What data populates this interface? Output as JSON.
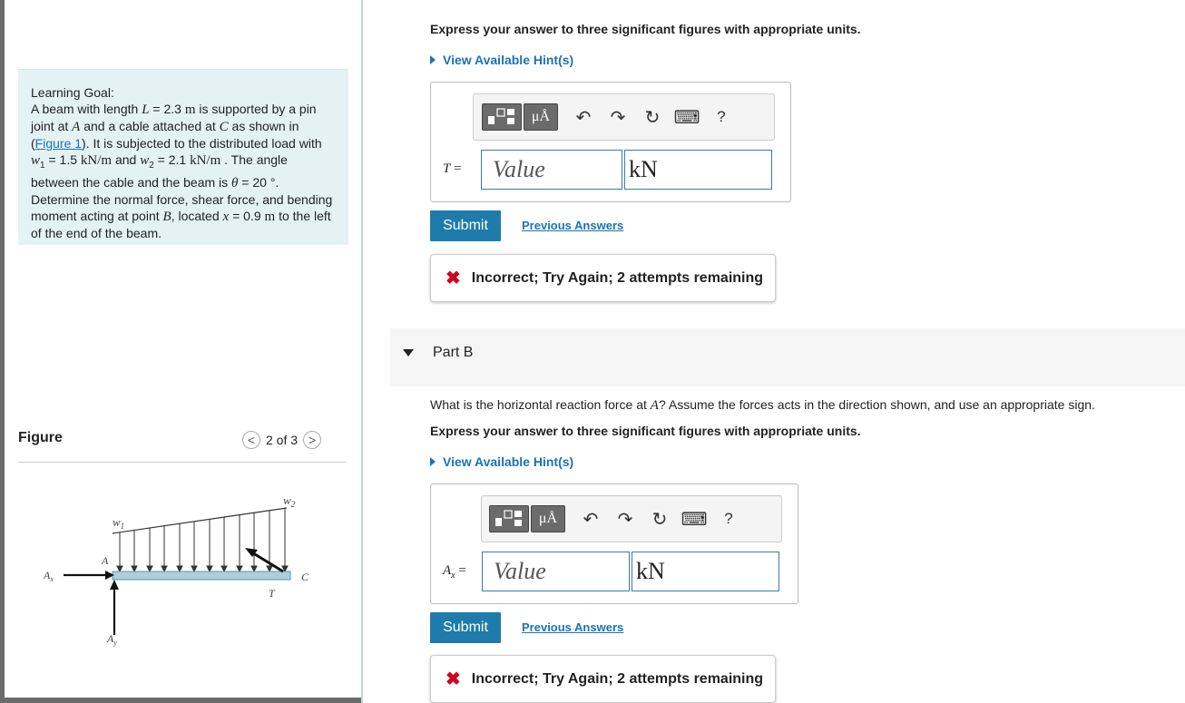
{
  "learning_goal": {
    "title": "Learning Goal:",
    "t1": "A beam with length ",
    "L": "L",
    "t2": " = 2.3 ",
    "m1": "m",
    "t3": " is supported by a pin joint at ",
    "A": "A",
    "t4": " and a cable attached at ",
    "C": "C",
    "t5": " as shown in (",
    "figure_link": "Figure 1",
    "t6": "). It is subjected to the distributed load with ",
    "w1": "w",
    "w1sub": "1",
    "t7": " = 1.5 ",
    "u1": "kN/m",
    "t8": " and ",
    "w2": "w",
    "w2sub": "2",
    "t9": " = 2.1 ",
    "u2": "kN/m",
    "t10": " . The angle between the cable and the beam is ",
    "theta": "θ",
    "t11": " = 20 °. Determine the normal force, shear force, and bending moment acting at point ",
    "B": "B",
    "t12": ", located ",
    "x": "x",
    "t13": " = 0.9 ",
    "m2": "m",
    "t14": " to the left of the end of the beam."
  },
  "figure": {
    "label": "Figure",
    "pager_text": "2 of 3",
    "prev_glyph": "<",
    "next_glyph": ">",
    "labels": {
      "w1": "w",
      "w1sub": "1",
      "w2": "w",
      "w2sub": "2",
      "A": "A",
      "Ax": "A",
      "Axsub": "x",
      "Ay": "A",
      "Aysub": "y",
      "T": "T",
      "C": "C"
    }
  },
  "part_a": {
    "express": "Express your answer to three significant figures with appropriate units.",
    "hint": "View Available Hint(s)",
    "var_label": "T =",
    "value_placeholder": "Value",
    "unit": "kN",
    "toolbar": {
      "mu": "μÅ",
      "help": "?"
    },
    "submit": "Submit",
    "previous": "Previous Answers",
    "feedback": "Incorrect; Try Again; 2 attempts remaining"
  },
  "part_b": {
    "title": "Part B",
    "question_1": "What is the horizontal reaction force at ",
    "question_A": "A",
    "question_2": "? Assume the forces acts in the direction shown, and use an appropriate sign.",
    "express": "Express your answer to three significant figures with appropriate units.",
    "hint": "View Available Hint(s)",
    "var_main": "A",
    "var_sub": "x",
    "var_eq": " =",
    "value_placeholder": "Value",
    "unit": "kN",
    "toolbar": {
      "mu": "μÅ",
      "help": "?"
    },
    "submit": "Submit",
    "previous": "Previous Answers",
    "feedback": "Incorrect; Try Again; 2 attempts remaining"
  },
  "icons": {
    "undo": "undo-icon",
    "redo": "redo-icon",
    "reset": "reset-icon",
    "keyboard": "keyboard-icon",
    "incorrect": "x-mark-icon"
  },
  "colors": {
    "link": "#1a73b5",
    "submit": "#1f7bab",
    "error": "#d0021b",
    "goal_bg": "#e4f2f4"
  }
}
